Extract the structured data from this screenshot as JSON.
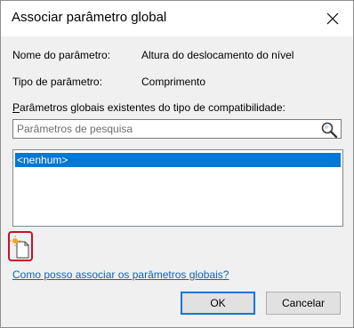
{
  "dialog": {
    "title": "Associar parâmetro global"
  },
  "info": {
    "name_label": "Nome do parâmetro:",
    "name_value": "Altura do deslocamento do nível",
    "type_label": "Tipo de parâmetro:",
    "type_value": "Comprimento"
  },
  "existing": {
    "label_mnemonic": "P",
    "label_rest": "arâmetros globais existentes do tipo de compatibilidade:"
  },
  "search": {
    "placeholder": "Parâmetros de pesquisa",
    "icon": "search-icon"
  },
  "list": {
    "items": [
      {
        "label": "<nenhum>",
        "selected": true
      }
    ]
  },
  "new_param_icon": "new-global-parameter-icon",
  "help_link": "Como posso associar os parâmetros globais?",
  "buttons": {
    "ok": "OK",
    "cancel": "Cancelar"
  },
  "colors": {
    "selection": "#0078d7",
    "highlight_border": "#c8102e",
    "link": "#0066cc"
  }
}
